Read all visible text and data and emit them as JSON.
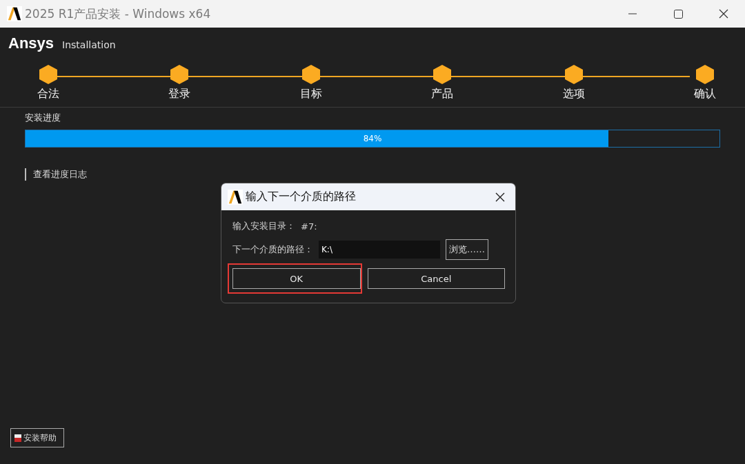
{
  "window": {
    "title": "2025 R1产品安装 - Windows x64"
  },
  "header": {
    "brand": "Ansys",
    "subtitle": "Installation"
  },
  "steps": [
    {
      "label": "合法",
      "done": true
    },
    {
      "label": "登录",
      "done": true
    },
    {
      "label": "目标",
      "done": true
    },
    {
      "label": "产品",
      "done": true
    },
    {
      "label": "选项",
      "done": true
    },
    {
      "label": "确认",
      "done": true
    }
  ],
  "progress": {
    "label": "安装进度",
    "level": 0.84,
    "reading": "84%"
  },
  "log_link": "查看进度日志",
  "help_button": "安装帮助",
  "dialog": {
    "title": "输入下一个介质的路径",
    "dir_label": "输入安装目录：",
    "dir_value": "#7:",
    "path_label": "下一个介质的路径：",
    "path_value": "K:\\",
    "browse": "浏览……",
    "ok": "OK",
    "cancel": "Cancel",
    "ok_highlighted": true
  }
}
